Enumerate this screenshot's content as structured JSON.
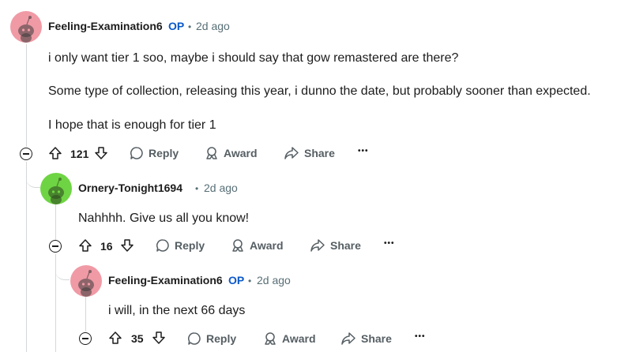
{
  "comments": [
    {
      "username": "Feeling-Examination6",
      "op_badge": "OP",
      "separator": "•",
      "time": "2d ago",
      "avatar_color": "#f09aa5",
      "body": [
        "i only want tier 1 soo, maybe i should say that gow remastered are there?",
        "Some type of collection, releasing this year, i dunno the date, but probably sooner than expected.",
        "I hope that is enough for tier 1"
      ],
      "votes": "121",
      "actions": {
        "reply": "Reply",
        "award": "Award",
        "share": "Share",
        "more": "•••"
      }
    },
    {
      "username": "Ornery-Tonight1694",
      "separator": "•",
      "time": "2d ago",
      "avatar_color": "#6fd443",
      "body": [
        "Nahhhh. Give us all you know!"
      ],
      "votes": "16",
      "actions": {
        "reply": "Reply",
        "award": "Award",
        "share": "Share",
        "more": "•••"
      }
    },
    {
      "username": "Feeling-Examination6",
      "op_badge": "OP",
      "separator": "•",
      "time": "2d ago",
      "avatar_color": "#f09aa5",
      "body": [
        "i will, in the next 66 days"
      ],
      "votes": "35",
      "actions": {
        "reply": "Reply",
        "award": "Award",
        "share": "Share",
        "more": "•••"
      }
    }
  ],
  "icons": {
    "upvote": "upvote-icon",
    "downvote": "downvote-icon",
    "reply": "reply-bubble-icon",
    "award": "award-icon",
    "share": "share-arrow-icon",
    "collapse": "collapse-minus-icon",
    "avatar": "snoo-avatar-icon"
  },
  "colors": {
    "op_badge": "#0a58c9",
    "meta": "#576f76",
    "action": "#555e63",
    "thread_line": "#d4d7d9"
  }
}
